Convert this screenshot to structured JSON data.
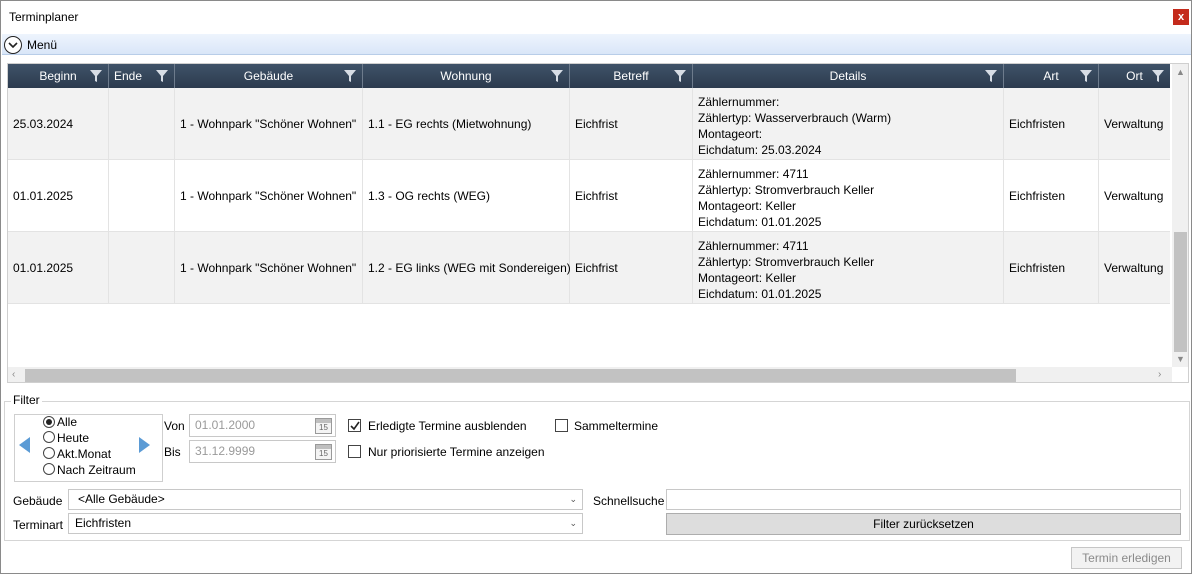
{
  "window": {
    "title": "Terminplaner",
    "close_label": "x"
  },
  "menu": {
    "label": "Menü"
  },
  "table": {
    "columns": [
      {
        "label": "Beginn"
      },
      {
        "label": "Ende"
      },
      {
        "label": "Gebäude"
      },
      {
        "label": "Wohnung"
      },
      {
        "label": "Betreff"
      },
      {
        "label": "Details"
      },
      {
        "label": "Art"
      },
      {
        "label": "Ort"
      }
    ],
    "rows": [
      {
        "beginn": "25.03.2024",
        "ende": "",
        "gebaeude": "1 - Wohnpark \"Schöner Wohnen\"",
        "wohnung": "1.1 - EG rechts (Mietwohnung)",
        "betreff": "Eichfrist",
        "details": [
          "Zählernummer:",
          "Zählertyp: Wasserverbrauch (Warm)",
          "Montageort:",
          "Eichdatum: 25.03.2024"
        ],
        "art": "Eichfristen",
        "ort": "Verwaltung"
      },
      {
        "beginn": "01.01.2025",
        "ende": "",
        "gebaeude": "1 - Wohnpark \"Schöner Wohnen\"",
        "wohnung": "1.3 - OG rechts (WEG)",
        "betreff": "Eichfrist",
        "details": [
          "Zählernummer: 4711",
          "Zählertyp: Stromverbrauch Keller",
          "Montageort: Keller",
          "Eichdatum: 01.01.2025"
        ],
        "art": "Eichfristen",
        "ort": "Verwaltung"
      },
      {
        "beginn": "01.01.2025",
        "ende": "",
        "gebaeude": "1 - Wohnpark \"Schöner Wohnen\"",
        "wohnung": "1.2 - EG links (WEG mit Sondereigen)",
        "betreff": "Eichfrist",
        "details": [
          "Zählernummer: 4711",
          "Zählertyp: Stromverbrauch Keller",
          "Montageort: Keller",
          "Eichdatum: 01.01.2025"
        ],
        "art": "Eichfristen",
        "ort": "Verwaltung"
      }
    ]
  },
  "filter": {
    "legend": "Filter",
    "range_options": [
      {
        "label": "Alle",
        "selected": true
      },
      {
        "label": "Heute",
        "selected": false
      },
      {
        "label": "Akt.Monat",
        "selected": false
      },
      {
        "label": "Nach Zeitraum",
        "selected": false
      }
    ],
    "von_label": "Von",
    "von_value": "01.01.2000",
    "bis_label": "Bis",
    "bis_value": "31.12.9999",
    "calendar_day": "15",
    "erledigte_label": "Erledigte Termine ausblenden",
    "erledigte_checked": true,
    "priorisiert_label": "Nur priorisierte Termine anzeigen",
    "priorisiert_checked": false,
    "sammel_label": "Sammeltermine",
    "sammel_checked": false,
    "gebaeude_label": "Gebäude",
    "gebaeude_value": "<Alle Gebäude>",
    "terminart_label": "Terminart",
    "terminart_value": "Eichfristen",
    "schnellsuche_label": "Schnellsuche",
    "schnellsuche_value": "",
    "reset_label": "Filter zurücksetzen"
  },
  "footer": {
    "done_label": "Termin erledigen"
  },
  "icons": {
    "close": "close-icon",
    "menu_toggle": "chevron-down-circle-icon",
    "column_filter": "funnel-icon",
    "calendar": "calendar-icon",
    "prev": "triangle-left-icon",
    "next": "triangle-right-icon"
  },
  "colors": {
    "header_bg": "#34465a",
    "close_bg": "#c42b1c",
    "nav_arrow": "#5b9bd5"
  }
}
